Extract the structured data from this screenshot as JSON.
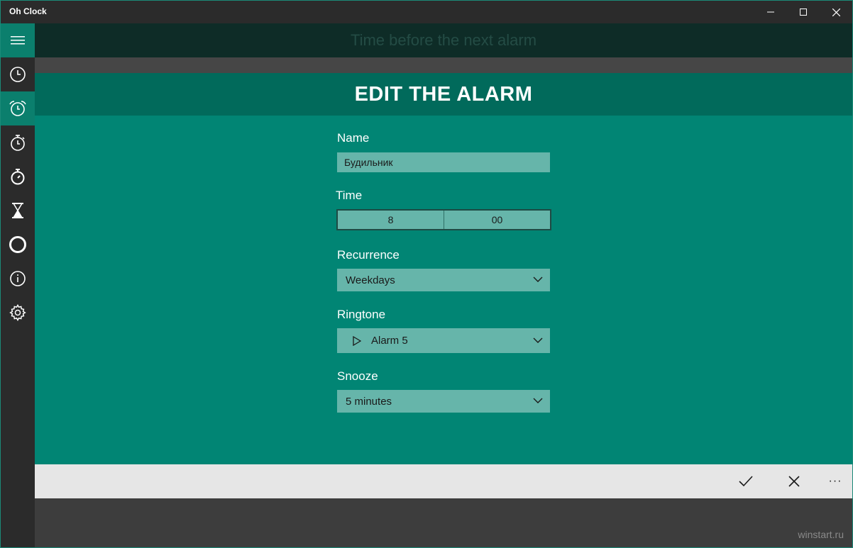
{
  "window": {
    "title": "Oh Clock"
  },
  "header": {
    "next_alarm_text": "Time before the next alarm"
  },
  "sidebar": {
    "items": [
      {
        "icon": "hamburger-menu-icon"
      },
      {
        "icon": "clock-icon"
      },
      {
        "icon": "alarm-clock-icon"
      },
      {
        "icon": "timer-icon"
      },
      {
        "icon": "stopwatch-icon"
      },
      {
        "icon": "hourglass-icon"
      },
      {
        "icon": "theme-circle-icon"
      },
      {
        "icon": "info-icon"
      },
      {
        "icon": "settings-gear-icon"
      }
    ]
  },
  "edit": {
    "title": "EDIT THE ALARM",
    "name_label": "Name",
    "name_value": "Будильник",
    "time_label": "Time",
    "time_hour": "8",
    "time_minute": "00",
    "recurrence_label": "Recurrence",
    "recurrence_value": "Weekdays",
    "ringtone_label": "Ringtone",
    "ringtone_value": "Alarm 5",
    "snooze_label": "Snooze",
    "snooze_value": "5 minutes"
  },
  "commands": {
    "accept_icon": "checkmark-icon",
    "cancel_icon": "close-icon",
    "more_label": "···"
  },
  "watermark": "winstart.ru",
  "colors": {
    "accent": "#018574",
    "accent_dark": "#016a5b",
    "field_bg": "#66b5aa",
    "sidebar_bg": "#2b2b2b"
  }
}
